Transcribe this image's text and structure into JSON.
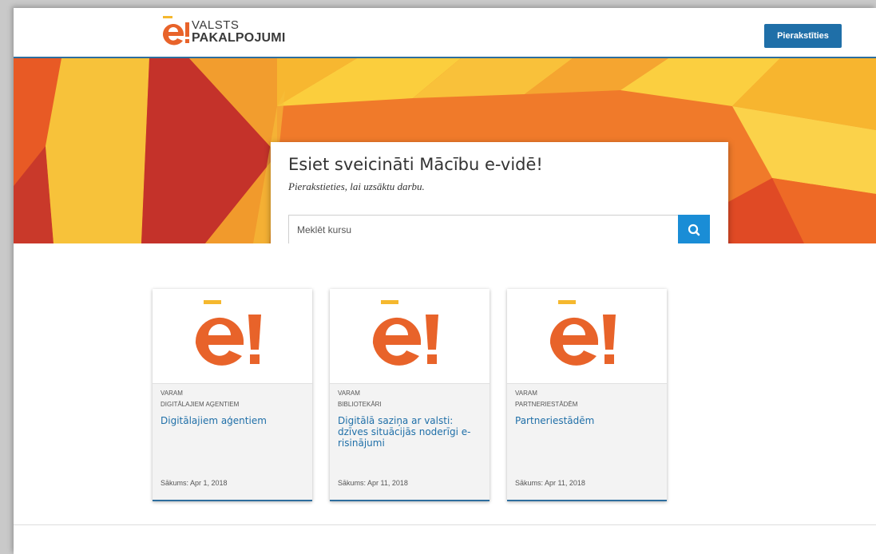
{
  "header": {
    "logo_line1": "VALSTS",
    "logo_line2": "PAKALPOJUMI",
    "login_label": "Pierakstīties"
  },
  "hero": {
    "title": "Esiet sveicināti Mācību e-vidē!",
    "subtitle": "Pierakstieties, lai uzsāktu darbu.",
    "search_placeholder": "Meklēt kursu"
  },
  "courses": [
    {
      "org": "VARAM",
      "category": "DIGITĀLAJIEM AĢENTIEM",
      "title": "Digitālajiem aģentiem",
      "start": "Sākums: Apr 1, 2018"
    },
    {
      "org": "VARAM",
      "category": "BIBLIOTEKĀRI",
      "title": "Digitālā saziņa ar valsti: dzīves situācijās noderīgi e-risinājumi",
      "start": "Sākums: Apr 11, 2018"
    },
    {
      "org": "VARAM",
      "category": "PARTNERIESTĀDĒM",
      "title": "Partneriestādēm",
      "start": "Sākums: Apr 11, 2018"
    }
  ],
  "colors": {
    "brand_blue": "#1f6fa8",
    "search_blue": "#1a8dd6",
    "orange": "#e8632a",
    "yellow": "#f5b82e"
  }
}
